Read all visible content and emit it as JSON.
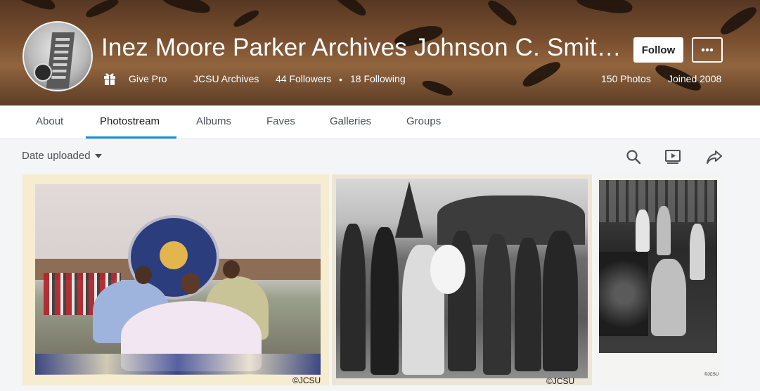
{
  "profile": {
    "name": "Inez Moore Parker Archives Johnson C. Smith...",
    "give_pro": "Give Pro",
    "realname": "JCSU Archives",
    "followers": "44 Followers",
    "separator": "•",
    "following": "18 Following",
    "photos": "150 Photos",
    "joined": "Joined 2008",
    "follow_label": "Follow"
  },
  "tabs": [
    "About",
    "Photostream",
    "Albums",
    "Faves",
    "Galleries",
    "Groups"
  ],
  "active_tab": "Photostream",
  "toolbar": {
    "sort_label": "Date uploaded"
  },
  "photos": [
    {
      "credit": "©JCSU"
    },
    {
      "credit": "©JCSU"
    },
    {
      "credit": "©JCSU"
    }
  ],
  "colors": {
    "accent": "#128fdc",
    "follow_bg": "#ffffff",
    "page_bg": "#f3f5f6"
  },
  "icons": [
    "gift-icon",
    "more-icon",
    "search-icon",
    "slideshow-icon",
    "share-icon"
  ]
}
